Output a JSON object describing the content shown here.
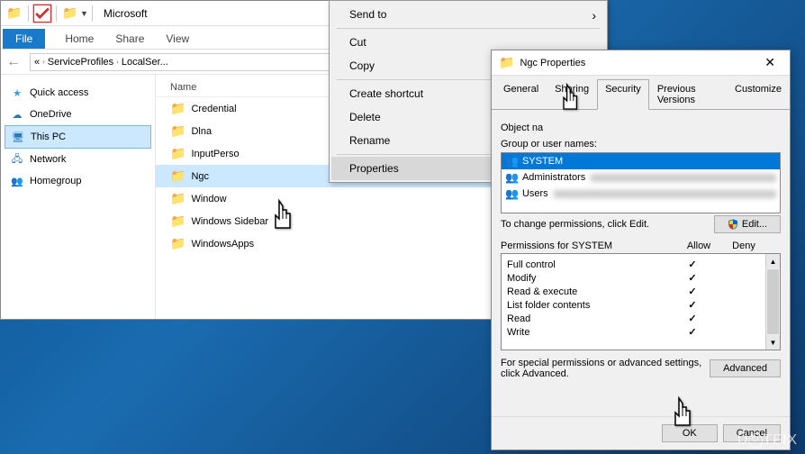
{
  "explorer": {
    "title": "Microsoft",
    "ribbon": {
      "file": "File",
      "home": "Home",
      "share": "Share",
      "view": "View"
    },
    "address": {
      "crumb1": "ServiceProfiles",
      "crumb2": "LocalSer..."
    },
    "sidebar": {
      "quick_access": "Quick access",
      "onedrive": "OneDrive",
      "this_pc": "This PC",
      "network": "Network",
      "homegroup": "Homegroup"
    },
    "filelist": {
      "header_name": "Name",
      "items": [
        {
          "name": "Credential"
        },
        {
          "name": "Dlna"
        },
        {
          "name": "InputPerso"
        },
        {
          "name": "Ngc"
        },
        {
          "name": "Window"
        },
        {
          "name": "Windows Sidebar"
        },
        {
          "name": "WindowsApps"
        }
      ]
    }
  },
  "context_menu": {
    "send_to": "Send to",
    "cut": "Cut",
    "copy": "Copy",
    "create_shortcut": "Create shortcut",
    "delete": "Delete",
    "rename": "Rename",
    "properties": "Properties"
  },
  "properties": {
    "title": "Ngc Properties",
    "tabs": {
      "general": "General",
      "sharing": "Sharing",
      "security": "Security",
      "previous": "Previous Versions",
      "customize": "Customize"
    },
    "object_name_label": "Object na",
    "group_label": "Group or user names:",
    "groups": [
      {
        "name": "SYSTEM"
      },
      {
        "name": "Administrators"
      },
      {
        "name": "Users"
      }
    ],
    "change_perm_text": "To change permissions, click Edit.",
    "edit_btn": "Edit...",
    "perm_header": "Permissions for SYSTEM",
    "col_allow": "Allow",
    "col_deny": "Deny",
    "permissions": [
      {
        "name": "Full control",
        "allow": true,
        "deny": false
      },
      {
        "name": "Modify",
        "allow": true,
        "deny": false
      },
      {
        "name": "Read & execute",
        "allow": true,
        "deny": false
      },
      {
        "name": "List folder contents",
        "allow": true,
        "deny": false
      },
      {
        "name": "Read",
        "allow": true,
        "deny": false
      },
      {
        "name": "Write",
        "allow": true,
        "deny": false
      }
    ],
    "advanced_text": "For special permissions or advanced settings, click Advanced.",
    "advanced_btn": "Advanced",
    "ok_btn": "OK",
    "cancel_btn": "Cancel"
  },
  "watermark": "U     TFIX"
}
